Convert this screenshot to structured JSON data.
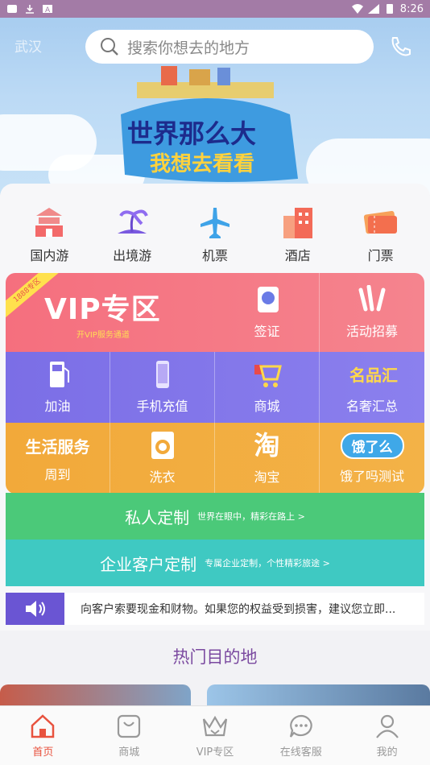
{
  "status_bar": {
    "time": "8:26"
  },
  "header": {
    "city": "武汉",
    "search_placeholder": "搜索你想去的地方"
  },
  "banner": {
    "headline": "世界那么大",
    "subline": "我想去看看"
  },
  "categories": [
    {
      "label": "国内游",
      "icon": "temple-icon"
    },
    {
      "label": "出境游",
      "icon": "palm-island-icon"
    },
    {
      "label": "机票",
      "icon": "airplane-icon"
    },
    {
      "label": "酒店",
      "icon": "hotel-icon"
    },
    {
      "label": "门票",
      "icon": "ticket-icon"
    }
  ],
  "vip": {
    "title": "VIP专区",
    "subtitle": "开VIP服务通道",
    "ribbon": "1888专区"
  },
  "grid": {
    "row1": [
      {
        "label": "签证"
      },
      {
        "label": "活动招募"
      }
    ],
    "row2": [
      {
        "label": "加油"
      },
      {
        "label": "手机充值"
      },
      {
        "label": "商城"
      },
      {
        "label": "名奢汇总"
      }
    ],
    "row3": [
      {
        "label": "周到",
        "logo": "生活服务"
      },
      {
        "label": "洗衣"
      },
      {
        "label": "淘宝",
        "logo": "淘"
      },
      {
        "label": "饿了吗测试",
        "logo": "饿了么"
      }
    ],
    "logo_minghui": "名品汇"
  },
  "private_custom": {
    "title": "私人定制",
    "subtitle": "世界在眼中，精彩在路上 >"
  },
  "enterprise_custom": {
    "title": "企业客户定制",
    "subtitle": "专属企业定制，个性精彩旅途 >"
  },
  "notice": {
    "text": "向客户索要现金和财物。如果您的权益受到损害，建议您立即..."
  },
  "hot_destinations": {
    "title": "热门目的地"
  },
  "tabs": [
    {
      "label": "首页",
      "active": true
    },
    {
      "label": "商城",
      "active": false
    },
    {
      "label": "VIP专区",
      "active": false
    },
    {
      "label": "在线客服",
      "active": false
    },
    {
      "label": "我的",
      "active": false
    }
  ],
  "colors": {
    "accent": "#e8523e",
    "vip_row": "#f56f7e",
    "purple_row": "#7b6ee6",
    "orange_row": "#f2a93a",
    "green_bar": "#4bc979",
    "teal_bar": "#3fc9c2"
  }
}
